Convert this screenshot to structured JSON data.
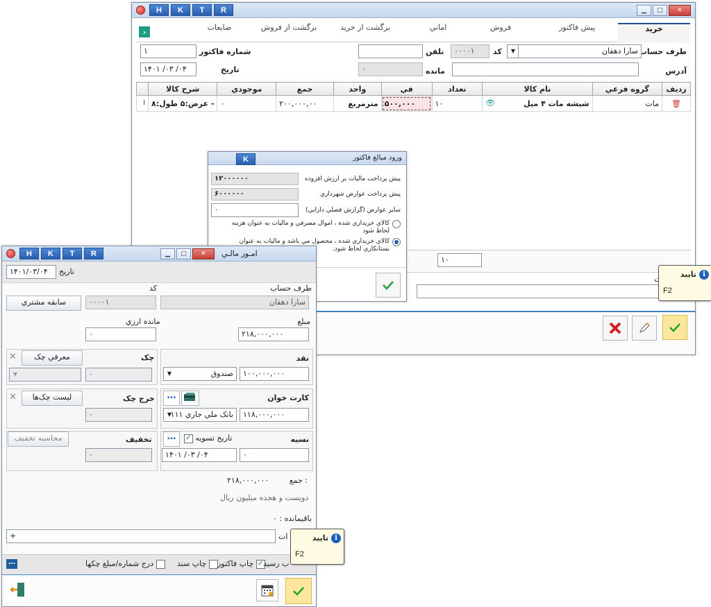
{
  "main_window": {
    "title_buttons": [
      "H",
      "K",
      "T",
      "R"
    ],
    "tabs": [
      "خرید",
      "پیش فاکتور",
      "فروش",
      "اماني",
      "برگشت از خرید",
      "برگشت از فروش",
      "ضایعات"
    ],
    "active_tab": "خرید",
    "account_label": "طرف حساب",
    "account_value": "سارا دهقان",
    "code_label": "کد",
    "code_value": "۰۰۰۰۱",
    "phone_label": "تلفن",
    "phone_value": "",
    "invoice_no_label": "شماره فاکتور",
    "invoice_no_value": "۱",
    "date_label": "تاریخ",
    "date_value": "۱۴۰۱ /۰۳ /۰۴",
    "address_label": "آدرس",
    "address_value": "",
    "balance_label": "مانده",
    "balance_value": "۰",
    "grid_headers": [
      "ردیف",
      "گروه فرعي",
      "نام کالا",
      "تعداد",
      "في",
      "واحد",
      "جمع",
      "موجودي",
      "شرح کالا"
    ],
    "grid_rows": [
      {
        "group": "مات",
        "name": "شیشه مات ۴ میل",
        "qty": "۱۰",
        "price": "۵۰۰,۰۰۰",
        "unit": "مترمربع",
        "total": "۲۰۰,۰۰۰,۰۰",
        "stock": "۰",
        "desc": "- عرض:۵  طول:۸",
        "cursor": "I"
      }
    ],
    "footer_qty": "۱۰",
    "footer_label_fragment": "ات",
    "tooltip_title": "تایید",
    "tooltip_key": "F2"
  },
  "amounts_dialog": {
    "title": "ورود مبالغ فاکتور",
    "title_button": "K",
    "rows": [
      {
        "label": "پیش پرداخت مالیات بر ارزش افزوده",
        "value": "۱۲۰۰۰۰۰۰"
      },
      {
        "label": "پیش پرداخت عوارض شهرداري",
        "value": "۶۰۰۰۰۰۰"
      },
      {
        "label": "سایر عوارض (گزارش فصلي دارایي)",
        "value": "۰"
      }
    ],
    "option1": "کالاي خریداري شده ، اموال مصرفي و مالیات به عنوان هزینه لحاظ شود",
    "option2": "کالاي خریداري شده ، محصول مي باشد و مالیات به عنوان بستانکاري لحاظ شود."
  },
  "finance_window": {
    "title": "امـور مالـي",
    "title_buttons": [
      "H",
      "K",
      "T",
      "R"
    ],
    "date_label": "تاریخ",
    "date_value": "۱۴۰۱/۰۳/۰۴",
    "account_label": "طرف حساب",
    "account_value": "سارا دهقان",
    "code_label": "کد",
    "code_value": "۰۰۰۰۱",
    "history_button": "سابقه مشتري",
    "amount_label": "مبلغ",
    "amount_value": "۲۱۸,۰۰۰,۰۰۰",
    "fx_balance_label": "مانده ارزي",
    "fx_balance_value": "۰",
    "cash_label": "نقد",
    "cash_value": "۱۰۰,۰۰۰,۰۰۰",
    "cash_box": "صندوق",
    "cheque_label": "چک",
    "cheque_intro_button": "معرفي چک",
    "cheque_value": "۰",
    "card_label": "کارت خوان",
    "card_value": "۱۱۸,۰۰۰,۰۰۰",
    "card_bank": "بانک ملي جاري ۱۱۱",
    "cheque_out_label": "خرج چک",
    "cheque_list_button": "لیست چک‌ها",
    "cheque_out_value": "۰",
    "credit_label": "نسیه",
    "settle_date_label": "تاریخ تسویه",
    "settle_date_value": "۱۴۰۱   /۰۳   /۰۴",
    "credit_value": "۰",
    "discount_label": "تخفیف",
    "discount_button": "محاسبه تخفیف",
    "discount_value": "۰",
    "sum_label": "جمع :",
    "sum_value": "۲۱۸,۰۰۰,۰۰۰",
    "sum_words": "دویست و هجده میلیون  ریال",
    "remaining": "باقیمانده : ۰",
    "notes_plus": "+",
    "notes_fragment": "ات",
    "receipt_fragment": "ب رسید",
    "print_invoice": "چاپ فاکتور",
    "print_doc": "چاپ سند",
    "cheque_numbers": "درج شماره/مبلغ چکها",
    "tooltip_title": "تایید",
    "tooltip_key": "F2"
  }
}
